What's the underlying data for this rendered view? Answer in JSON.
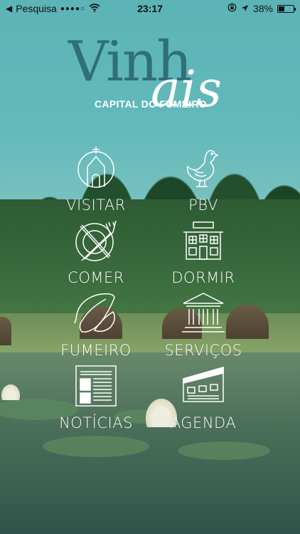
{
  "status_bar": {
    "back_app": "Pesquisa",
    "signal": "●●●●○",
    "time": "23:17",
    "battery": "38%",
    "battery_level": 0.38,
    "icons": [
      "back-chevron-icon",
      "wifi-icon",
      "orientation-lock-icon",
      "location-arrow-icon",
      "battery-icon"
    ]
  },
  "logo": {
    "word": "Vinh",
    "script": "ais",
    "subtitle": "CAPITAL DO FUMEIRO"
  },
  "menu": {
    "items": [
      {
        "label": "VISITAR",
        "icon": "chapel-icon"
      },
      {
        "label": "PBV",
        "icon": "chicken-icon"
      },
      {
        "label": "COMER",
        "icon": "plate-cutlery-icon"
      },
      {
        "label": "DORMIR",
        "icon": "house-icon"
      },
      {
        "label": "FUMEIRO",
        "icon": "sausage-icon"
      },
      {
        "label": "SERVIÇOS",
        "icon": "institution-icon"
      },
      {
        "label": "NOTÍCIAS",
        "icon": "newspaper-icon"
      },
      {
        "label": "AGENDA",
        "icon": "calendar-icon"
      }
    ]
  },
  "colors": {
    "sky": "#5cb4b6",
    "logo_teal": "#2f6f77",
    "icon_white": "#ffffff"
  }
}
